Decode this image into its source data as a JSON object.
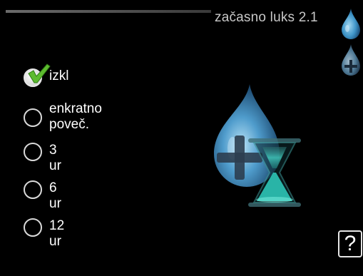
{
  "header": {
    "title": "začasno luks 2.1"
  },
  "options": [
    {
      "label": "izkl",
      "checked": true
    },
    {
      "label": "enkratno\npoveč.",
      "checked": false
    },
    {
      "label": "3 ur",
      "checked": false
    },
    {
      "label": "6 ur",
      "checked": false
    },
    {
      "label": "12 ur",
      "checked": false
    }
  ],
  "labels": {
    "opt0": "izkl",
    "opt1_line1": "enkratno",
    "opt1_line2": "poveč.",
    "opt2": "3 ur",
    "opt3": "6 ur",
    "opt4": "12 ur"
  },
  "help": {
    "glyph": "?"
  },
  "colors": {
    "accent_blue": "#4aa8d8",
    "check_green": "#5dbb2f",
    "hourglass_teal": "#2fd0c0"
  },
  "icons": {
    "side_top": "water-drop-icon",
    "side_bottom": "water-drop-plus-icon",
    "main_art": "hot-water-boost-timer-icon",
    "help": "help-icon",
    "check": "checkmark-icon"
  }
}
